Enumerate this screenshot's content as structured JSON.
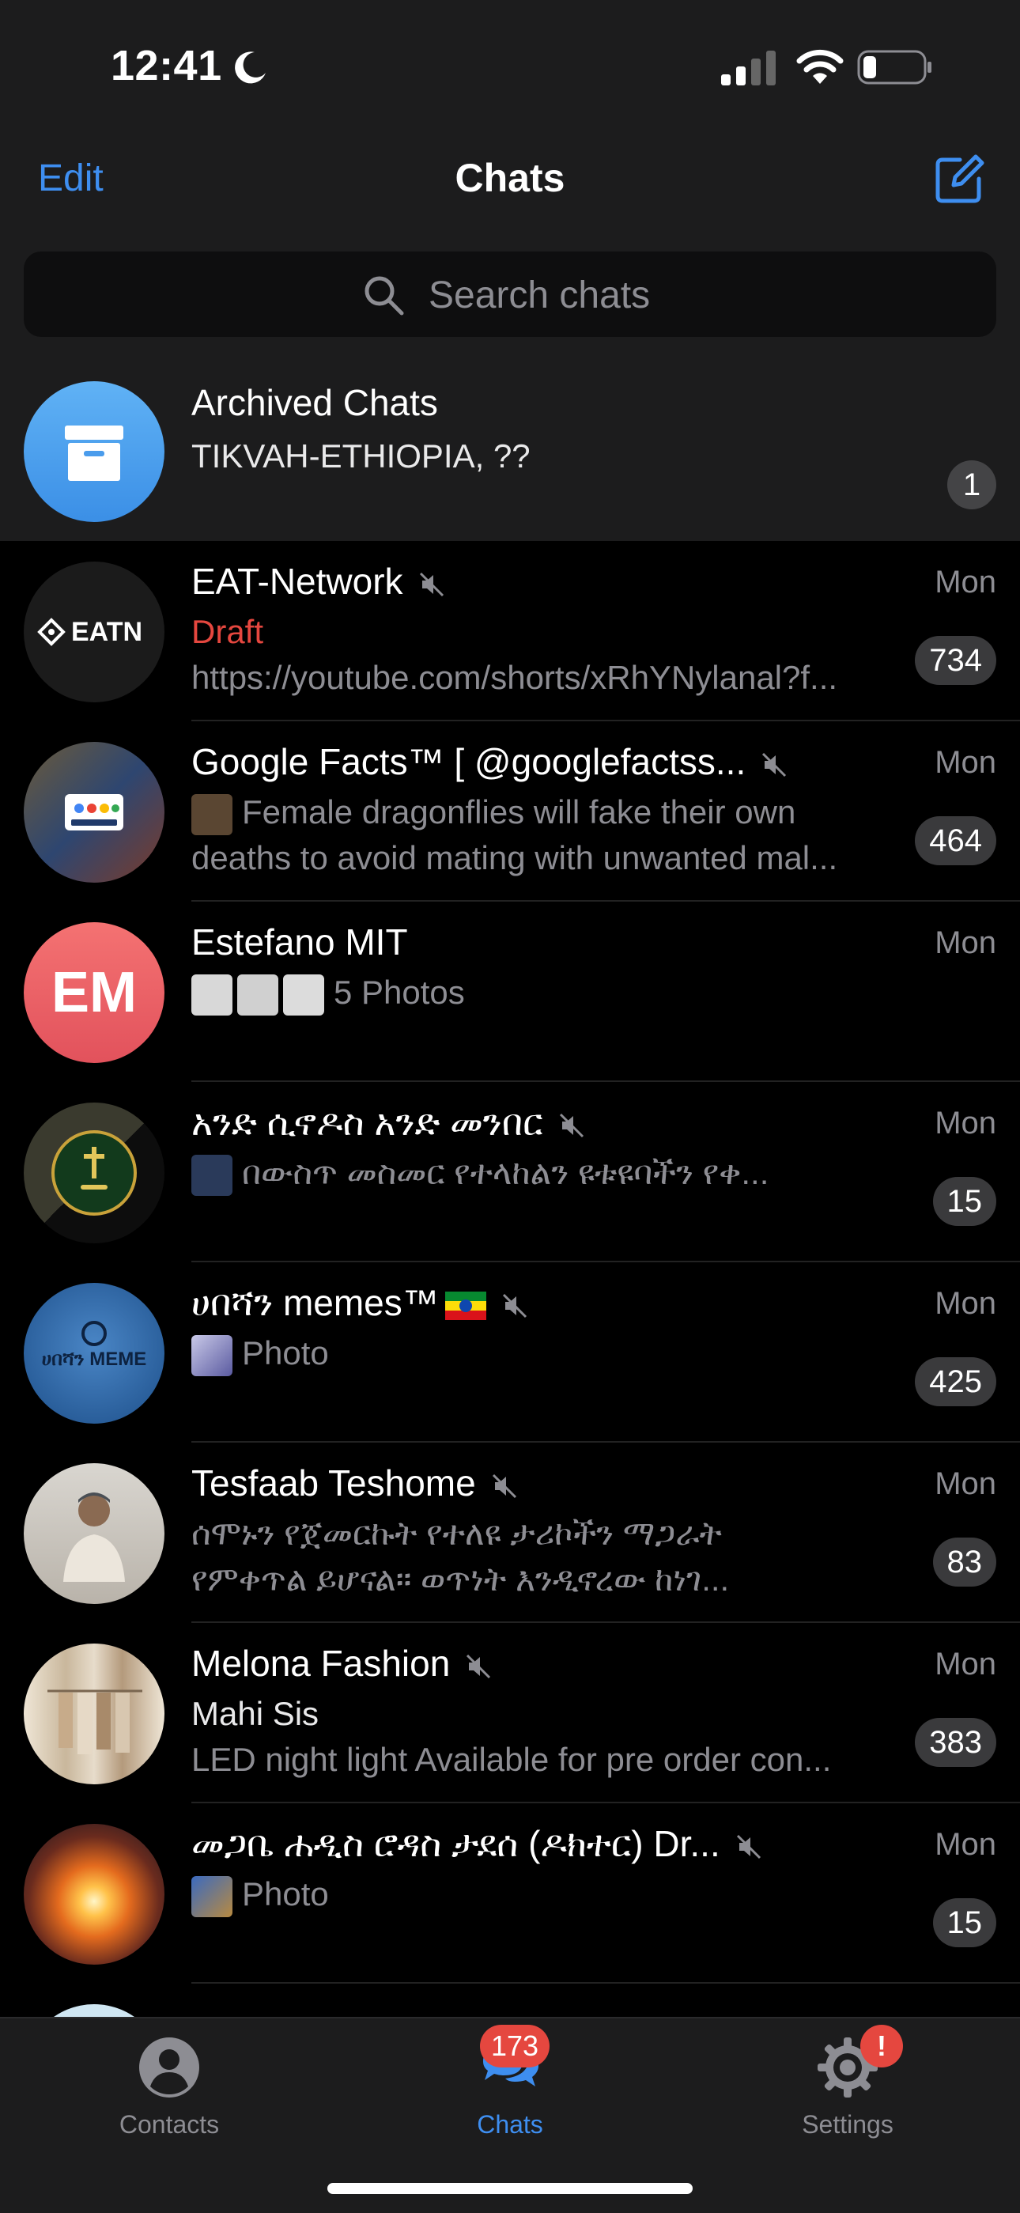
{
  "status_bar": {
    "time": "12:41"
  },
  "nav": {
    "edit": "Edit",
    "title": "Chats"
  },
  "search": {
    "placeholder": "Search chats"
  },
  "archived": {
    "name": "Archived Chats",
    "preview": "TIKVAH-ETHIOPIA, ??",
    "badge": "1"
  },
  "chats": [
    {
      "name": "EAT-Network",
      "line1": "Draft",
      "line2": "https://youtube.com/shorts/xRhYNylanal?f...",
      "date": "Mon",
      "badge": "734",
      "avatar_text": "EATN"
    },
    {
      "name": "Google Facts™ [      @googlefactss...",
      "line1": "Female dragonflies will fake their own",
      "line2": "deaths to avoid mating with unwanted mal...",
      "date": "Mon",
      "badge": "464"
    },
    {
      "name": "Estefano MIT",
      "line1": "5 Photos",
      "date": "Mon",
      "avatar_text": "EM"
    },
    {
      "name": "አንድ ሲኖዶስ አንድ መንበር",
      "line1": "በውስጥ መስመር የተላከልን ዩቱዩባችን የቀ...",
      "date": "Mon",
      "badge": "15"
    },
    {
      "name": "ሀበሻን memes™",
      "line1": "Photo",
      "date": "Mon",
      "badge": "425",
      "avatar_text": "ሀበሻን MEME"
    },
    {
      "name": "Tesfaab Teshome",
      "line1": "ሰሞኑን የጀመርኩት የተለዩ ታሪኮችን ማጋራት",
      "line2": "የምቀጥል ይሆናል። ወጥነት እንዲኖረው ከነገ...",
      "date": "Mon",
      "badge": "83"
    },
    {
      "name": "Melona Fashion",
      "line1": "Mahi Sis",
      "line2": "LED night light Available for pre order con...",
      "date": "Mon",
      "badge": "383"
    },
    {
      "name": "መጋቤ ሐዲስ ሮዳስ ታደሰ (ዶክተር) Dr...",
      "line1": "Photo",
      "date": "Mon",
      "badge": "15"
    }
  ],
  "tabs": {
    "contacts": "Contacts",
    "chats": "Chats",
    "chats_badge": "173",
    "settings": "Settings",
    "settings_badge": "!"
  },
  "colors": {
    "accent": "#3e8ef0",
    "badge_red": "#e5473f",
    "badge_grey": "#3a3a3c"
  }
}
